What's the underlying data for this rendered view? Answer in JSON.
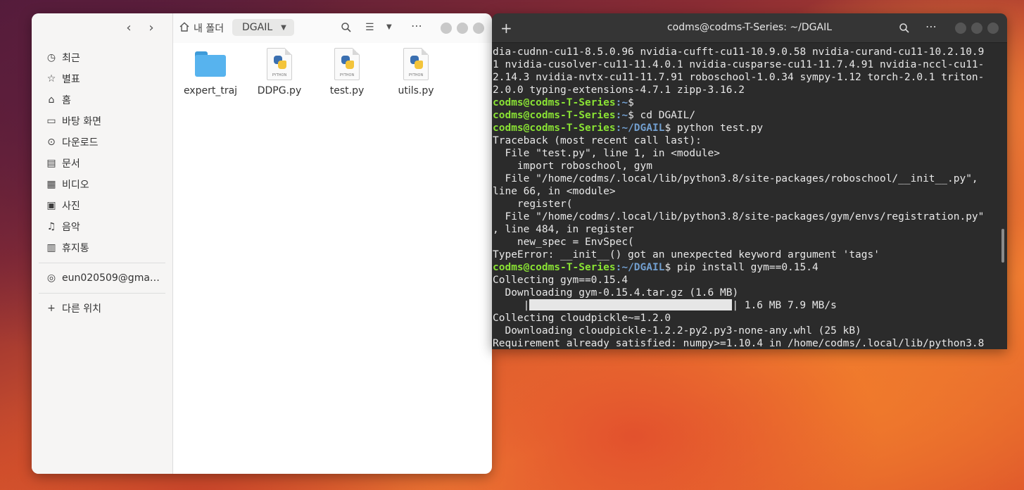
{
  "files": {
    "nav": {
      "back": "‹",
      "forward": "›"
    },
    "path": {
      "home_label": "내 폴더",
      "current": "DGAIL"
    },
    "sidebar": {
      "items": [
        {
          "label": "최근",
          "icon": "clock-icon"
        },
        {
          "label": "별표",
          "icon": "star-icon"
        },
        {
          "label": "홈",
          "icon": "home-icon"
        },
        {
          "label": "바탕 화면",
          "icon": "desktop-icon"
        },
        {
          "label": "다운로드",
          "icon": "download-icon"
        },
        {
          "label": "문서",
          "icon": "document-icon"
        },
        {
          "label": "비디오",
          "icon": "video-icon"
        },
        {
          "label": "사진",
          "icon": "image-icon"
        },
        {
          "label": "음악",
          "icon": "music-icon"
        },
        {
          "label": "휴지통",
          "icon": "trash-icon"
        }
      ],
      "account": "eun020509@gma…",
      "other_locations": "다른 위치"
    },
    "items": [
      {
        "name": "expert_traj",
        "type": "folder"
      },
      {
        "name": "DDPG.py",
        "type": "python"
      },
      {
        "name": "test.py",
        "type": "python"
      },
      {
        "name": "utils.py",
        "type": "python"
      }
    ],
    "python_badge": "PYTHON"
  },
  "terminal": {
    "title": "codms@codms-T-Series: ~/DGAIL",
    "user": "codms@codms-T-Series",
    "lines": [
      {
        "kind": "text",
        "text": "dia-cudnn-cu11-8.5.0.96 nvidia-cufft-cu11-10.9.0.58 nvidia-curand-cu11-10.2.10.9"
      },
      {
        "kind": "text",
        "text": "1 nvidia-cusolver-cu11-11.4.0.1 nvidia-cusparse-cu11-11.7.4.91 nvidia-nccl-cu11-"
      },
      {
        "kind": "text",
        "text": "2.14.3 nvidia-nvtx-cu11-11.7.91 roboschool-1.0.34 sympy-1.12 torch-2.0.1 triton-"
      },
      {
        "kind": "text",
        "text": "2.0.0 typing-extensions-4.7.1 zipp-3.16.2"
      },
      {
        "kind": "prompt",
        "path": ":~",
        "cmd": "$ "
      },
      {
        "kind": "prompt",
        "path": ":~",
        "cmd": "$ cd DGAIL/"
      },
      {
        "kind": "prompt",
        "path": ":~/DGAIL",
        "cmd": "$ python test.py"
      },
      {
        "kind": "text",
        "text": "Traceback (most recent call last):"
      },
      {
        "kind": "text",
        "text": "  File \"test.py\", line 1, in <module>"
      },
      {
        "kind": "text",
        "text": "    import roboschool, gym"
      },
      {
        "kind": "text",
        "text": "  File \"/home/codms/.local/lib/python3.8/site-packages/roboschool/__init__.py\","
      },
      {
        "kind": "text",
        "text": "line 66, in <module>"
      },
      {
        "kind": "text",
        "text": "    register("
      },
      {
        "kind": "text",
        "text": "  File \"/home/codms/.local/lib/python3.8/site-packages/gym/envs/registration.py\""
      },
      {
        "kind": "text",
        "text": ", line 484, in register"
      },
      {
        "kind": "text",
        "text": "    new_spec = EnvSpec("
      },
      {
        "kind": "text",
        "text": "TypeError: __init__() got an unexpected keyword argument 'tags'"
      },
      {
        "kind": "prompt",
        "path": ":~/DGAIL",
        "cmd": "$ pip install gym==0.15.4"
      },
      {
        "kind": "text",
        "text": "Collecting gym==0.15.4"
      },
      {
        "kind": "text",
        "text": "  Downloading gym-0.15.4.tar.gz (1.6 MB)"
      },
      {
        "kind": "progress",
        "pre": "     |",
        "post": "| 1.6 MB 7.9 MB/s",
        "fraction": 1.0
      },
      {
        "kind": "text",
        "text": "Collecting cloudpickle~=1.2.0"
      },
      {
        "kind": "text",
        "text": "  Downloading cloudpickle-1.2.2-py2.py3-none-any.whl (25 kB)"
      },
      {
        "kind": "text",
        "text": "Requirement already satisfied: numpy>=1.10.4 in /home/codms/.local/lib/python3.8"
      }
    ]
  }
}
